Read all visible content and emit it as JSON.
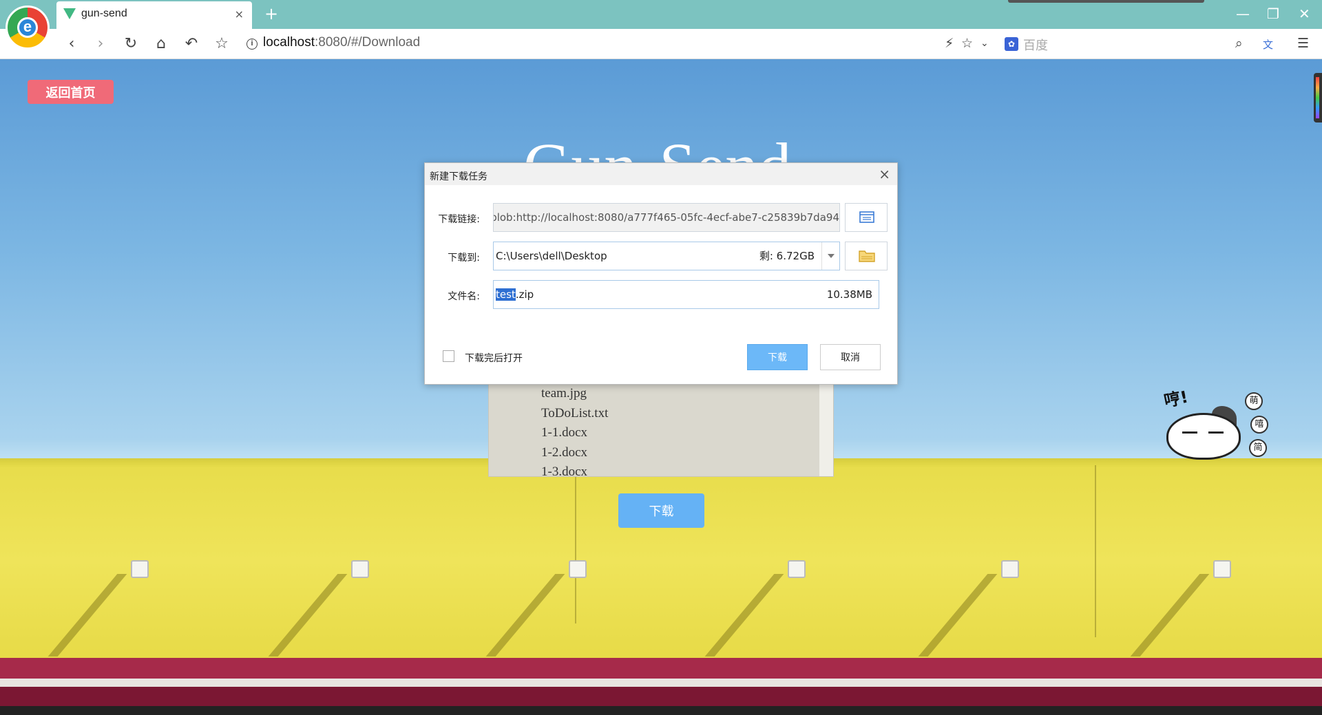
{
  "browser": {
    "tab_title": "gun-send",
    "tab_close": "×",
    "new_tab": "+",
    "url_host": "localhost",
    "url_rest": ":8080/#/Download",
    "search_placeholder": "百度",
    "logo_letter": "e"
  },
  "page": {
    "back_home_label": "返回首页",
    "bg_title": "Gun-Send",
    "files": [
      "team.jpg",
      "ToDoList.txt",
      "1-1.docx",
      "1-2.docx",
      "1-3.docx"
    ],
    "download_label": "下载",
    "mascot_text": "哼!",
    "mascot_badges": [
      "萌",
      "嘻",
      "简"
    ]
  },
  "dialog": {
    "title": "新建下载任务",
    "url_label": "下载链接:",
    "url_value": "blob:http://localhost:8080/a777f465-05fc-4ecf-abe7-c25839b7da94",
    "save_to_label": "下载到:",
    "save_path": "C:\\Users\\dell\\Desktop",
    "free_space": "剩: 6.72GB",
    "filename_label": "文件名:",
    "filename_selected": "test",
    "filename_ext": ".zip",
    "file_size": "10.38MB",
    "open_after_label": "下载完后打开",
    "download_label": "下载",
    "cancel_label": "取消"
  },
  "colors": {
    "titlebar": "#7cc3c0",
    "back_home_button": "#f06a78",
    "download_button": "#65b2f5",
    "dialog_download_button": "#6cb8f8",
    "selection": "#2e6fd2"
  }
}
